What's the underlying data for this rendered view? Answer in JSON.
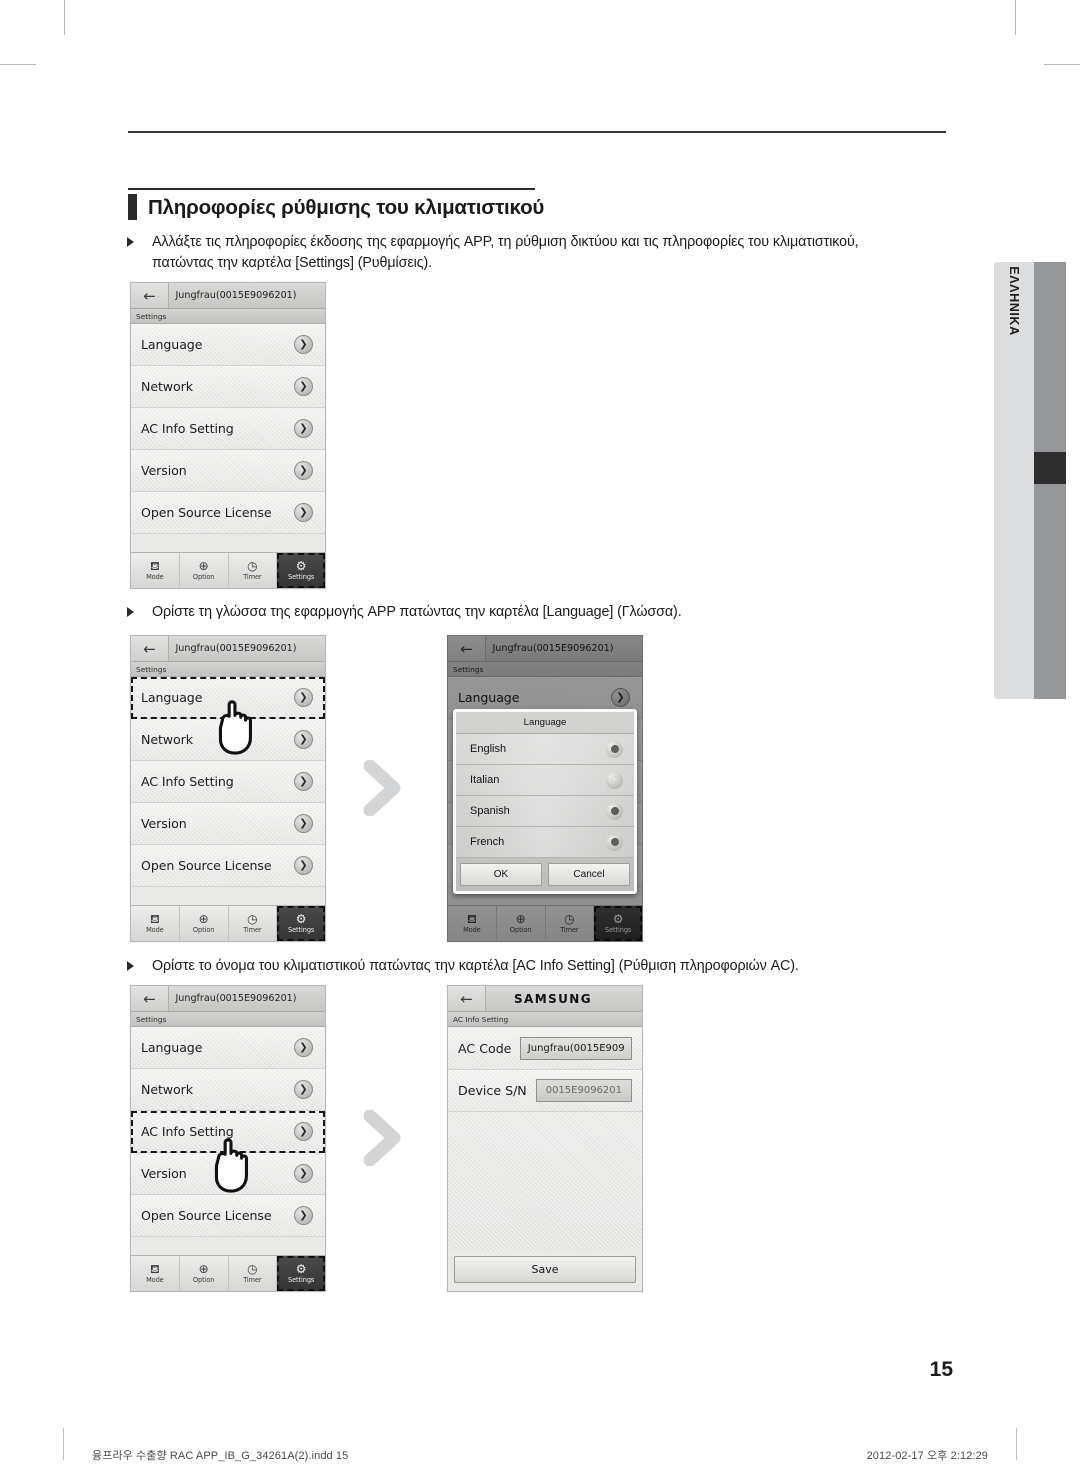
{
  "document": {
    "heading": "Πληροφορίες ρύθμισης του κλιματιστικού",
    "page_number": "15",
    "side_tab_label": "ΕΛΛΗΝΙΚΑ",
    "footer_left": "융프라우 수출향 RAC APP_IB_G_34261A(2).indd   15",
    "footer_right": "2012-02-17   오후 2:12:29"
  },
  "bullets": {
    "b1": "Αλλάξτε τις πληροφορίες έκδοσης της εφαρμογής APP, τη ρύθμιση δικτύου και τις πληροφορίες του κλιματιστικού, πατώντας την καρτέλα [Settings] (Ρυθμίσεις).",
    "b2": "Ορίστε τη γλώσσα της εφαρμογής APP πατώντας την καρτέλα [Language] (Γλώσσα).",
    "b3": "Ορίστε το όνομα του κλιματιστικού πατώντας την καρτέλα [AC Info Setting] (Ρύθμιση πληροφοριών AC)."
  },
  "settings_screen": {
    "back_icon": "←",
    "title": "Jungfrau(0015E9096201)",
    "subtitle": "Settings",
    "chevron_icon": "❯",
    "rows": [
      {
        "label": "Language"
      },
      {
        "label": "Network"
      },
      {
        "label": "AC Info Setting"
      },
      {
        "label": "Version"
      },
      {
        "label": "Open Source License"
      }
    ],
    "tabs": [
      {
        "label": "Mode",
        "icon": "mode-icon",
        "glyph": "⛾"
      },
      {
        "label": "Option",
        "icon": "option-icon",
        "glyph": "⊕"
      },
      {
        "label": "Timer",
        "icon": "timer-icon",
        "glyph": "◷"
      },
      {
        "label": "Settings",
        "icon": "gear-icon",
        "glyph": "⚙"
      }
    ],
    "active_tab": "Settings"
  },
  "language_dialog": {
    "title": "Language",
    "options": [
      {
        "label": "English",
        "selected": true
      },
      {
        "label": "Italian",
        "selected": false
      },
      {
        "label": "Spanish",
        "selected": true
      },
      {
        "label": "French",
        "selected": true
      }
    ],
    "ok_label": "OK",
    "cancel_label": "Cancel"
  },
  "ac_info_screen": {
    "back_icon": "←",
    "brand": "SAMSUNG",
    "subtitle": "AC Info Setting",
    "fields": [
      {
        "label": "AC Code",
        "value": "Jungfrau(0015E909",
        "readonly": false
      },
      {
        "label": "Device S/N",
        "value": "0015E9096201",
        "readonly": true
      }
    ],
    "save_label": "Save"
  },
  "colors": {
    "ink": "#1a1a1a",
    "rule": "#3a3a3a",
    "side_tab_bg": "#dcdddf",
    "side_strip": "#949699",
    "arrow": "#d3d4d6"
  }
}
